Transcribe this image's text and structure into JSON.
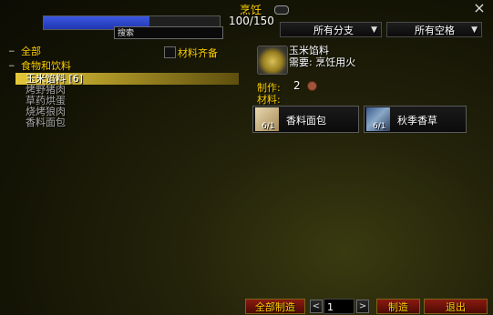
{
  "window": {
    "title": "烹饪",
    "close": "×"
  },
  "progress": {
    "text": "100/150",
    "fraction": 0.6
  },
  "search": {
    "placeholder": "搜索"
  },
  "filters": {
    "branch": "所有分支",
    "slot": "所有空格"
  },
  "materials_checkbox": {
    "label": "材料齐备",
    "checked": false
  },
  "tree": {
    "all": {
      "mark": "−",
      "label": "全部"
    },
    "category": {
      "mark": "−",
      "label": "食物和饮料"
    },
    "recipes": [
      {
        "label": "玉米馅料 [6]",
        "state": "selected",
        "color": "#ffffff"
      },
      {
        "label": "烤野猪肉",
        "state": "gray",
        "color": "#a8a8a8"
      },
      {
        "label": "草药烘蛋",
        "state": "gray",
        "color": "#a8a8a8"
      },
      {
        "label": "烧烤狼肉",
        "state": "gray",
        "color": "#a8a8a8"
      },
      {
        "label": "香料面包",
        "state": "gray",
        "color": "#a8a8a8"
      }
    ]
  },
  "detail": {
    "item_name": "玉米馅料",
    "requires": "需要: 烹饪用火",
    "make_label": "制作:",
    "make_count": "2",
    "materials_label": "材料:",
    "reagents": [
      {
        "name": "香料面包",
        "count": "6/1",
        "icon": "bread-icon"
      },
      {
        "name": "秋季香草",
        "count": "6/1",
        "icon": "herb-icon"
      }
    ]
  },
  "bottom": {
    "make_all": "全部制造",
    "decrement": "<",
    "quantity": "1",
    "increment": ">",
    "make": "制造",
    "exit": "退出"
  },
  "colors": {
    "gold_text": "#ffd100",
    "progress_fill": "#2c48d0",
    "button_red": "#6a1208"
  }
}
